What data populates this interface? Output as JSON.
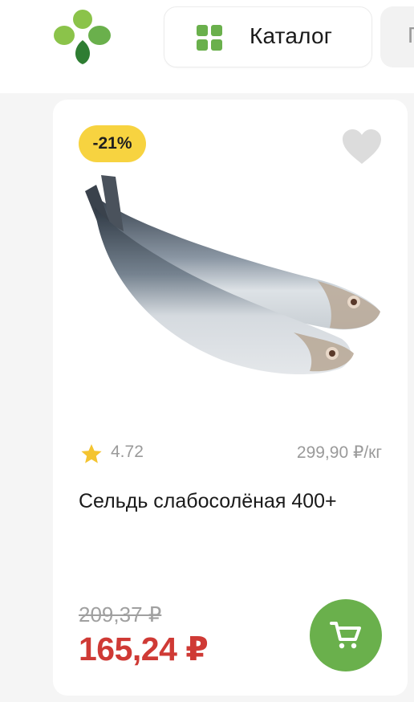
{
  "header": {
    "logo": {
      "icon": "clover-logo-icon"
    },
    "catalog_button": {
      "label": "Каталог",
      "icon": "grid-icon"
    },
    "next_button": {
      "label": "П"
    }
  },
  "product_card": {
    "discount_badge": "-21%",
    "favorite_icon": "heart-icon",
    "image": "herring-fish-image",
    "rating": "4.72",
    "unit_price": "299,90 ₽/кг",
    "title": "Сельдь слабосолёная 400+",
    "old_price": "209,37 ₽",
    "current_price": "165,24 ₽",
    "cart_icon": "shopping-cart-icon"
  },
  "colors": {
    "brand_green": "#6ab04c",
    "badge_yellow": "#f7d340",
    "price_red": "#cf3a35",
    "star_yellow": "#f4c430"
  }
}
